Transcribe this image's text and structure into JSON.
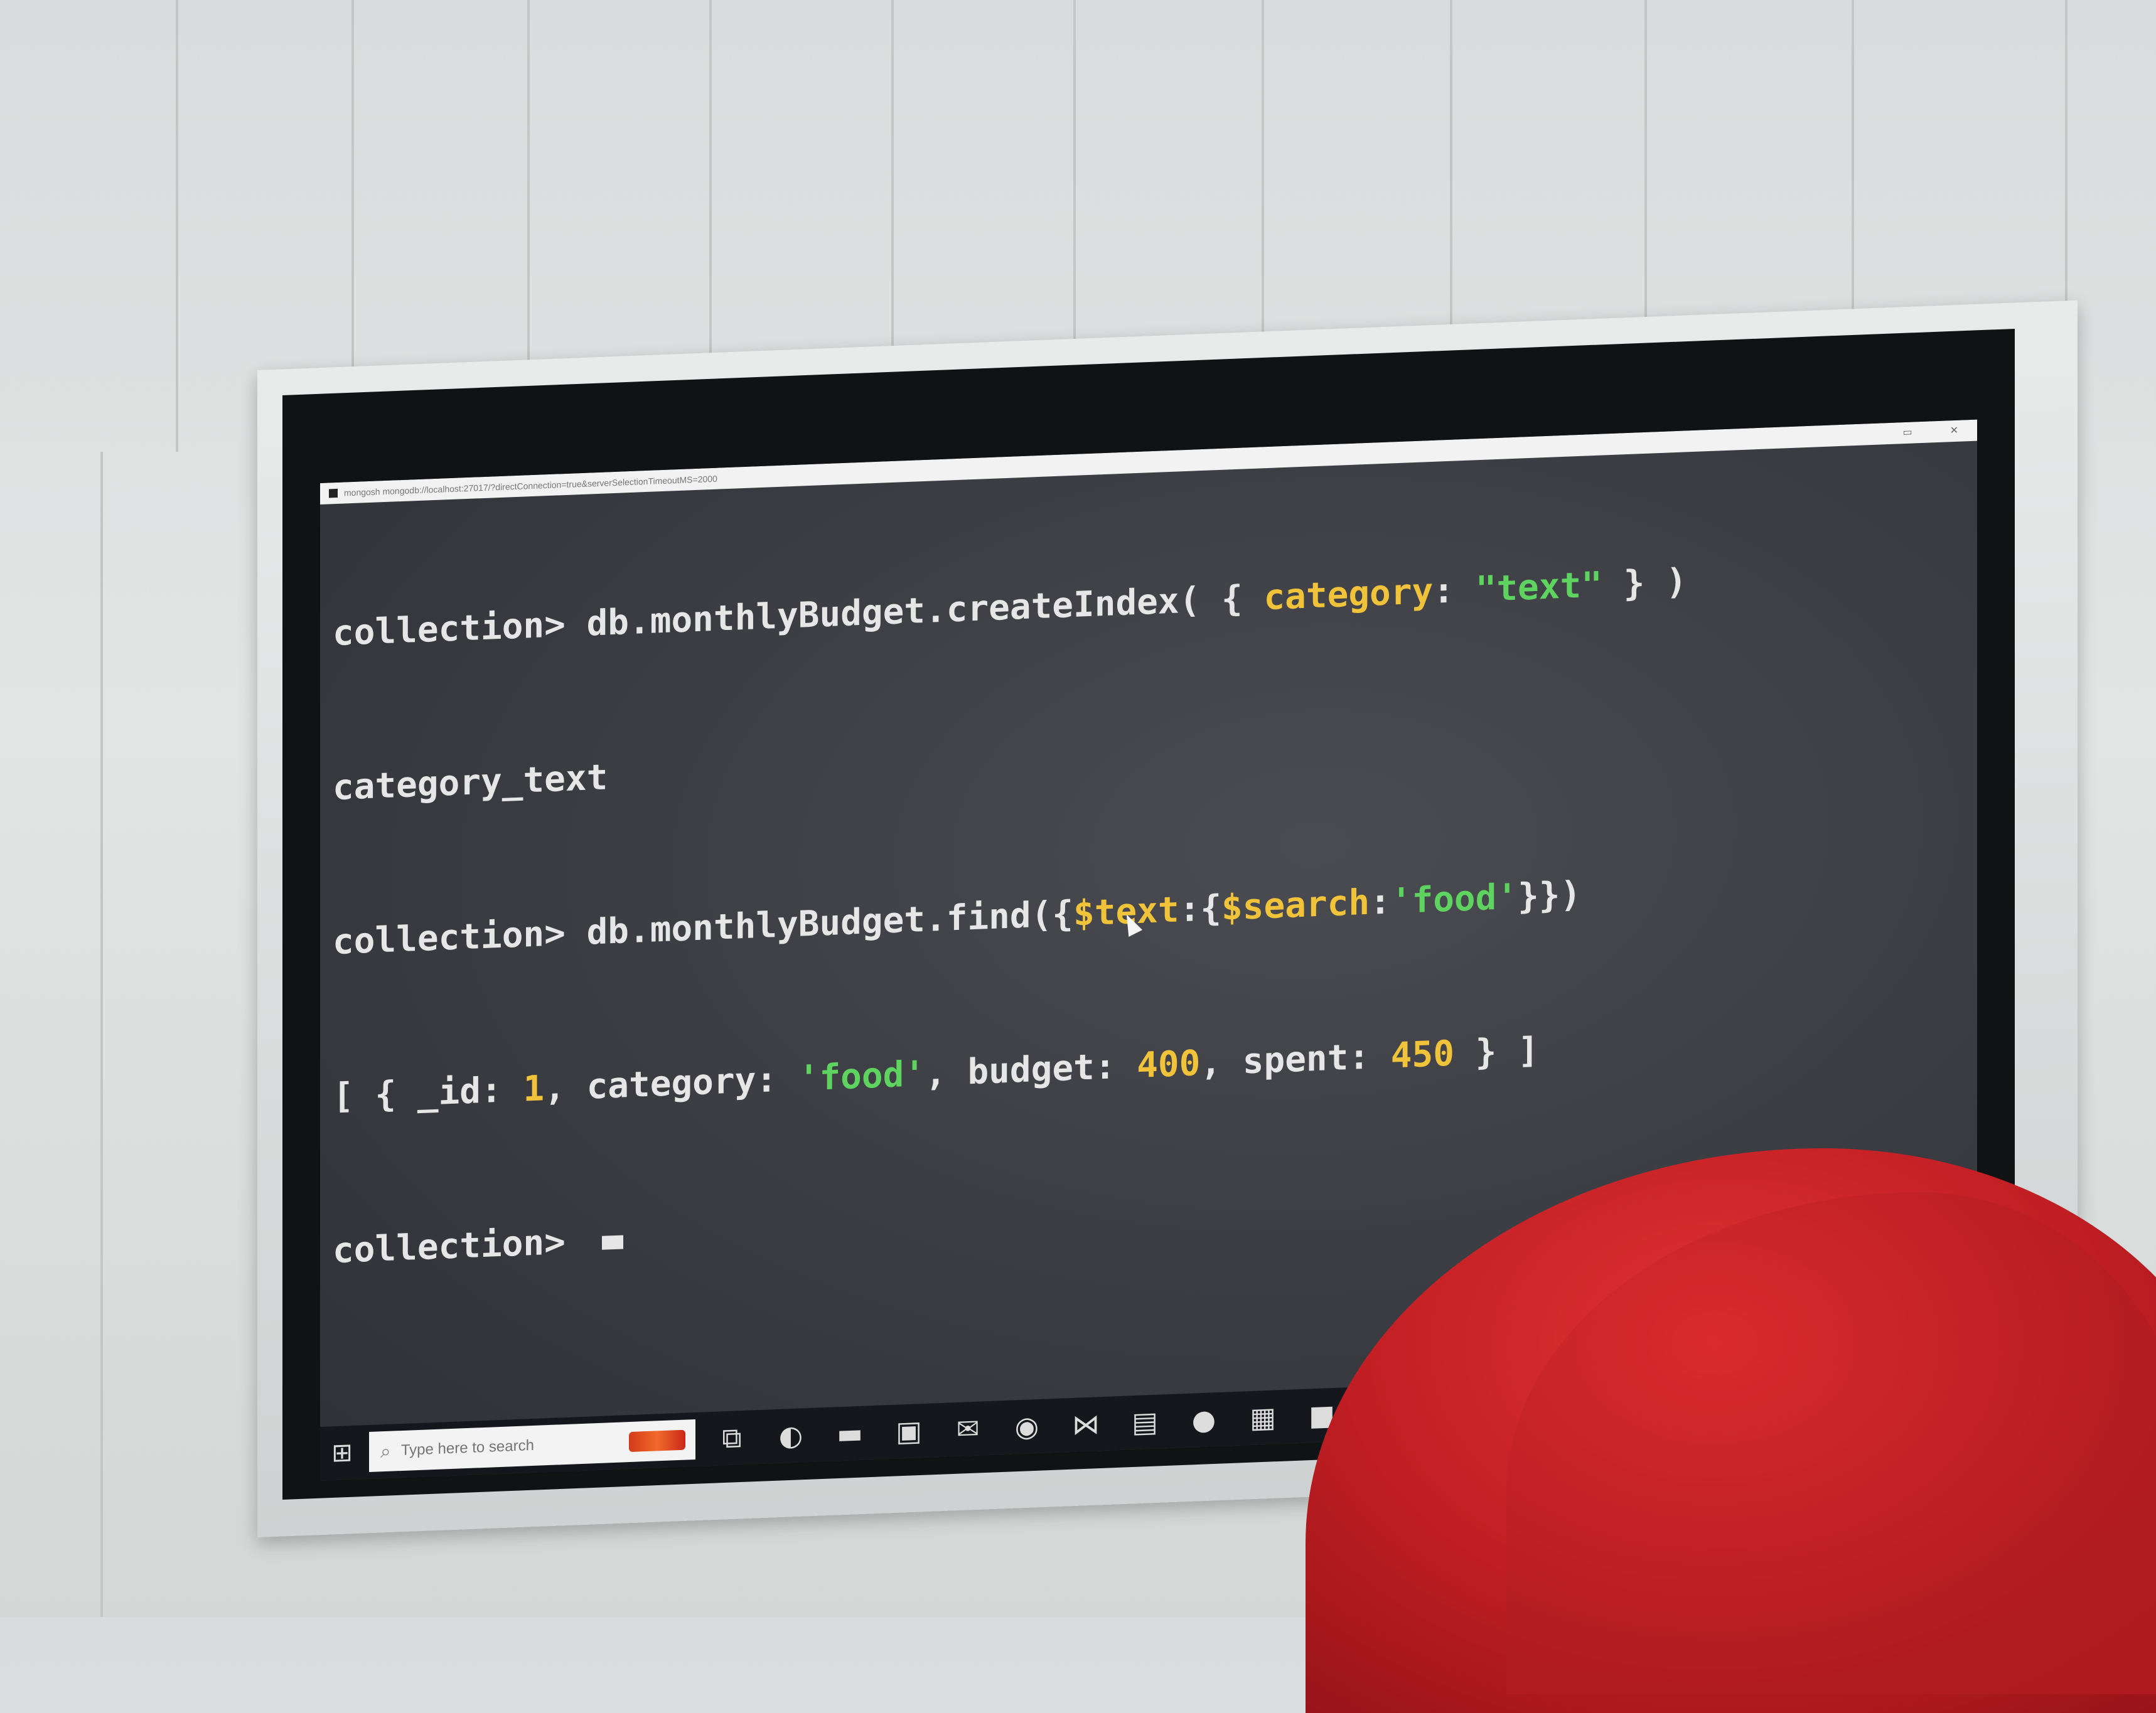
{
  "window": {
    "title": "mongosh mongodb://localhost:27017/?directConnection=true&serverSelectionTimeoutMS=2000",
    "minimize_glyph": "▭",
    "close_glyph": "✕"
  },
  "terminal": {
    "line1": {
      "prompt": "collection> ",
      "cmd_start": "db.monthlyBudget.createIndex( { ",
      "key": "category",
      "colon": ": ",
      "value": "\"text\"",
      "cmd_end": " } )"
    },
    "line2": {
      "output": "category_text"
    },
    "line3": {
      "prompt": "collection> ",
      "cmd_start": "db.monthlyBudget.find({",
      "text_op": "$text",
      "sep1": ":{",
      "search_op": "$search",
      "sep2": ":",
      "search_value": "'food'",
      "cmd_end": "}})"
    },
    "line4": {
      "p1": "[ { _id: ",
      "id_value": "1",
      "p2": ", category: ",
      "category_value": "'food'",
      "p3": ", budget: ",
      "budget_value": "400",
      "p4": ", spent: ",
      "spent_value": "450",
      "p5": " } ]"
    },
    "line5": {
      "prompt": "collection> "
    }
  },
  "taskbar": {
    "start_glyph": "⊞",
    "search_glyph": "⌕",
    "search_placeholder": "Type here to search",
    "icons": [
      {
        "name": "task-view-icon",
        "glyph": "⧉"
      },
      {
        "name": "edge-icon",
        "glyph": "◐"
      },
      {
        "name": "file-explorer-icon",
        "glyph": "▬"
      },
      {
        "name": "store-icon",
        "glyph": "▣"
      },
      {
        "name": "mail-icon",
        "glyph": "✉"
      },
      {
        "name": "chrome-icon",
        "glyph": "◉"
      },
      {
        "name": "vscode-icon",
        "glyph": "⋈"
      },
      {
        "name": "notepad-icon",
        "glyph": "▤"
      },
      {
        "name": "app-circle-icon",
        "glyph": "●"
      },
      {
        "name": "photos-icon",
        "glyph": "▦"
      },
      {
        "name": "terminal-app-icon",
        "glyph": "■"
      },
      {
        "name": "chrome-alt-icon",
        "glyph": "◎"
      }
    ]
  },
  "colors": {
    "terminal_bg": "#3a3c42",
    "terminal_text": "#e6e6e6",
    "syntax_yellow": "#f0c33a",
    "syntax_green": "#5fd35f",
    "taskbar_bg": "#15171c"
  }
}
